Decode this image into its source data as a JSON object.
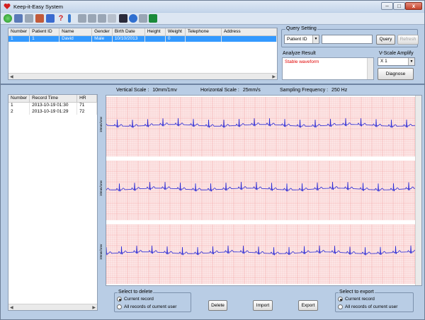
{
  "window": {
    "title": "Keep-it-Easy System"
  },
  "patients": {
    "columns": [
      "Number",
      "Patient ID",
      "Name",
      "Gender",
      "Birth Date",
      "Height",
      "Weight",
      "Telephone",
      "Address"
    ],
    "rows": [
      [
        "1",
        "1",
        "David",
        "Male",
        "10/10/2013",
        "",
        "0",
        "",
        ""
      ]
    ]
  },
  "query": {
    "group_label": "Query Setting",
    "field_value": "Patient ID",
    "search_value": "",
    "query_label": "Query",
    "refresh_label": "Refresh"
  },
  "analyze": {
    "label": "Analyze Result",
    "result": "Stable waveform",
    "result_color": "#e00000"
  },
  "vscale": {
    "label": "V-Scale Amplify",
    "value": "X 1",
    "diagnose_label": "Diagnose"
  },
  "records": {
    "columns": [
      "Number",
      "Record Time",
      "HR"
    ],
    "rows": [
      [
        "1",
        "2013-10-19 01:30",
        "71"
      ],
      [
        "2",
        "2013-10-19 01:29",
        "72"
      ]
    ]
  },
  "scales": {
    "vertical_label": "Vertical Scale :",
    "vertical_value": "10mm/1mv",
    "horizontal_label": "Horizontal Scale :",
    "horizontal_value": "25mm/s",
    "freq_label": "Sampling Frequency :",
    "freq_value": "250 Hz"
  },
  "ecg": {
    "strip_label": "10mm/1mv",
    "grid_color": "#f3a3a3",
    "grid_bg": "#fdebeb",
    "trace_color": "#2b2bd6"
  },
  "delete_box": {
    "title": "Select to delete",
    "opt1": "Current record",
    "opt2": "All records of current user"
  },
  "export_box": {
    "title": "Select to export",
    "opt1": "Current record",
    "opt2": "All records of current user"
  },
  "buttons": {
    "delete": "Delete",
    "import": "Import",
    "export": "Export"
  }
}
